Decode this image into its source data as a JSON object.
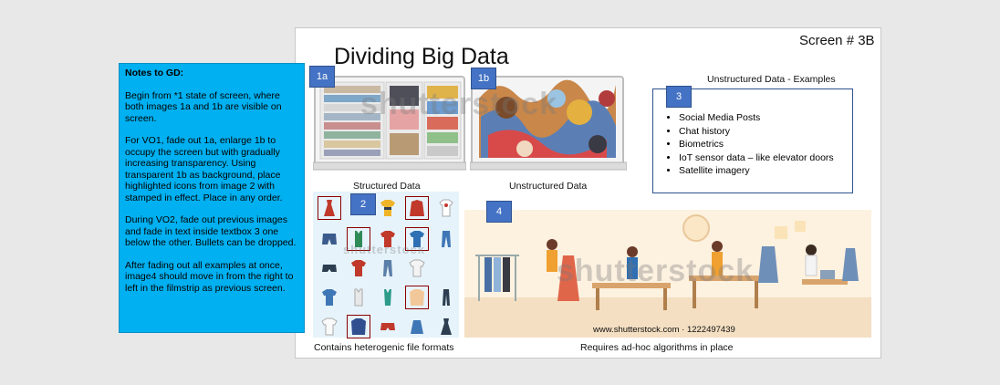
{
  "slide": {
    "title": "Dividing Big Data",
    "screen_number": "Screen # 3B"
  },
  "notes": {
    "heading": "Notes to GD:",
    "paragraphs": [
      "Begin from *1 state of screen, where both images 1a and 1b are visible on screen.",
      "For VO1, fade out 1a, enlarge 1b to occupy the screen but with gradually increasing transparency. Using transparent 1b as background, place highlighted icons from image 2 with stamped in effect. Place in any order.",
      "During VO2, fade out previous images and fade in text inside textbox 3 one below the other. Bullets can be dropped.",
      "After fading out all examples at once, image4 should move in from the right to left in the filmstrip as previous screen."
    ]
  },
  "badges": {
    "b1a": "1a",
    "b1b": "1b",
    "b2": "2",
    "b3": "3",
    "b4": "4"
  },
  "captions": {
    "structured": "Structured Data",
    "unstructured": "Unstructured Data",
    "examples_title": "Unstructured Data - Examples",
    "heterogenic": "Contains heterogenic file formats",
    "adhoc": "Requires ad-hoc algorithms in place",
    "stock_id": "www.shutterstock.com · 1222497439"
  },
  "examples": [
    "Social Media Posts",
    "Chat history",
    "Biometrics",
    "IoT sensor data – like elevator doors",
    "Satellite imagery"
  ],
  "watermark": "shutterstock",
  "colors": {
    "notes_bg": "#00b0f0",
    "badge_bg": "#4472c4",
    "highlight": "#8b0000"
  }
}
